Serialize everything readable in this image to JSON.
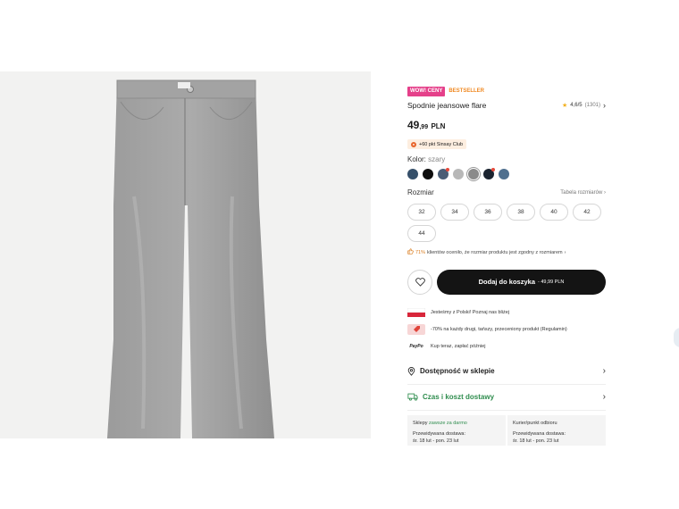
{
  "badges": {
    "wow": "WOW! CENY",
    "bestseller": "BESTSELLER"
  },
  "product": {
    "title": "Spodnie jeansowe flare",
    "rating": "4,6/5",
    "rating_count": "(1301)",
    "price_main": "49",
    "price_dec": ",99",
    "price_currency": "PLN"
  },
  "club": {
    "text": "+60 pkt Sinsay Club"
  },
  "color": {
    "label": "Kolor:",
    "value": "szary"
  },
  "swatches": [
    {
      "color": "#36506a",
      "dot": false,
      "selected": false
    },
    {
      "color": "#0e0e0e",
      "dot": false,
      "selected": false
    },
    {
      "color": "#4b5d75",
      "dot": true,
      "selected": false
    },
    {
      "color": "#b8b8b8",
      "dot": false,
      "selected": false
    },
    {
      "color": "#8a8a8a",
      "dot": false,
      "selected": true
    },
    {
      "color": "#1b2430",
      "dot": true,
      "selected": false
    },
    {
      "color": "#4f6f8e",
      "dot": false,
      "selected": false
    }
  ],
  "size": {
    "label": "Rozmiar",
    "table_link": "Tabela rozmiarów",
    "options": [
      "32",
      "34",
      "36",
      "38",
      "40",
      "42",
      "44"
    ]
  },
  "fit_note": {
    "pct": "71%",
    "text": "klientów oceniło, że rozmiar produktu jest zgodny z rozmiarem"
  },
  "cta": {
    "add_label": "Dodaj do koszyka",
    "old_price": "- 49,99 PLN"
  },
  "perks": [
    {
      "icon": "poland-flag-icon",
      "text": "Jesteśmy z Polski! Poznaj nas bliżej"
    },
    {
      "icon": "discount-tag-icon",
      "text": "-70% na każdy drugi, tańszy, przeceniony produkt (Regulamin)"
    },
    {
      "icon": "paypo-icon",
      "text": "Kup teraz, zapłać później"
    }
  ],
  "paypo_label": "PayPo",
  "links": {
    "store": "Dostępność w sklepie",
    "delivery": "Czas i koszt dostawy"
  },
  "delivery": {
    "stores_label": "Sklepy",
    "stores_free": "zawsze za darmo",
    "courier_label": "Kurier/punkt odbioru",
    "estimated": "Przewidywana dostawa:",
    "date_range": "śr. 18 lut - pon. 23 lut"
  },
  "colors": {
    "accent_pink": "#e5408a",
    "accent_orange": "#f08a24",
    "green": "#2f8d4e",
    "cta_black": "#141414"
  }
}
